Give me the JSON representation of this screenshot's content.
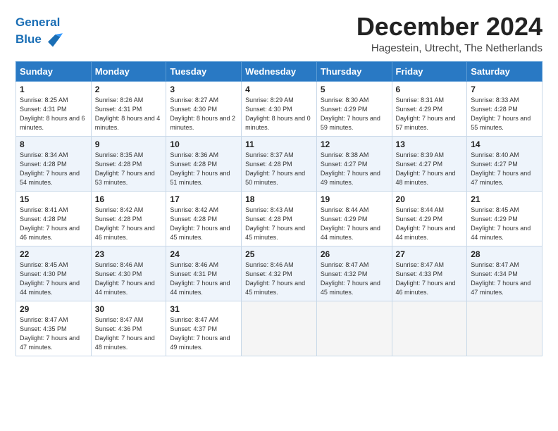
{
  "header": {
    "logo_line1": "General",
    "logo_line2": "Blue",
    "month": "December 2024",
    "location": "Hagestein, Utrecht, The Netherlands"
  },
  "weekdays": [
    "Sunday",
    "Monday",
    "Tuesday",
    "Wednesday",
    "Thursday",
    "Friday",
    "Saturday"
  ],
  "weeks": [
    [
      {
        "day": "1",
        "sunrise": "8:25 AM",
        "sunset": "4:31 PM",
        "daylight": "8 hours and 6 minutes."
      },
      {
        "day": "2",
        "sunrise": "8:26 AM",
        "sunset": "4:31 PM",
        "daylight": "8 hours and 4 minutes."
      },
      {
        "day": "3",
        "sunrise": "8:27 AM",
        "sunset": "4:30 PM",
        "daylight": "8 hours and 2 minutes."
      },
      {
        "day": "4",
        "sunrise": "8:29 AM",
        "sunset": "4:30 PM",
        "daylight": "8 hours and 0 minutes."
      },
      {
        "day": "5",
        "sunrise": "8:30 AM",
        "sunset": "4:29 PM",
        "daylight": "7 hours and 59 minutes."
      },
      {
        "day": "6",
        "sunrise": "8:31 AM",
        "sunset": "4:29 PM",
        "daylight": "7 hours and 57 minutes."
      },
      {
        "day": "7",
        "sunrise": "8:33 AM",
        "sunset": "4:28 PM",
        "daylight": "7 hours and 55 minutes."
      }
    ],
    [
      {
        "day": "8",
        "sunrise": "8:34 AM",
        "sunset": "4:28 PM",
        "daylight": "7 hours and 54 minutes."
      },
      {
        "day": "9",
        "sunrise": "8:35 AM",
        "sunset": "4:28 PM",
        "daylight": "7 hours and 53 minutes."
      },
      {
        "day": "10",
        "sunrise": "8:36 AM",
        "sunset": "4:28 PM",
        "daylight": "7 hours and 51 minutes."
      },
      {
        "day": "11",
        "sunrise": "8:37 AM",
        "sunset": "4:28 PM",
        "daylight": "7 hours and 50 minutes."
      },
      {
        "day": "12",
        "sunrise": "8:38 AM",
        "sunset": "4:27 PM",
        "daylight": "7 hours and 49 minutes."
      },
      {
        "day": "13",
        "sunrise": "8:39 AM",
        "sunset": "4:27 PM",
        "daylight": "7 hours and 48 minutes."
      },
      {
        "day": "14",
        "sunrise": "8:40 AM",
        "sunset": "4:27 PM",
        "daylight": "7 hours and 47 minutes."
      }
    ],
    [
      {
        "day": "15",
        "sunrise": "8:41 AM",
        "sunset": "4:28 PM",
        "daylight": "7 hours and 46 minutes."
      },
      {
        "day": "16",
        "sunrise": "8:42 AM",
        "sunset": "4:28 PM",
        "daylight": "7 hours and 46 minutes."
      },
      {
        "day": "17",
        "sunrise": "8:42 AM",
        "sunset": "4:28 PM",
        "daylight": "7 hours and 45 minutes."
      },
      {
        "day": "18",
        "sunrise": "8:43 AM",
        "sunset": "4:28 PM",
        "daylight": "7 hours and 45 minutes."
      },
      {
        "day": "19",
        "sunrise": "8:44 AM",
        "sunset": "4:29 PM",
        "daylight": "7 hours and 44 minutes."
      },
      {
        "day": "20",
        "sunrise": "8:44 AM",
        "sunset": "4:29 PM",
        "daylight": "7 hours and 44 minutes."
      },
      {
        "day": "21",
        "sunrise": "8:45 AM",
        "sunset": "4:29 PM",
        "daylight": "7 hours and 44 minutes."
      }
    ],
    [
      {
        "day": "22",
        "sunrise": "8:45 AM",
        "sunset": "4:30 PM",
        "daylight": "7 hours and 44 minutes."
      },
      {
        "day": "23",
        "sunrise": "8:46 AM",
        "sunset": "4:30 PM",
        "daylight": "7 hours and 44 minutes."
      },
      {
        "day": "24",
        "sunrise": "8:46 AM",
        "sunset": "4:31 PM",
        "daylight": "7 hours and 44 minutes."
      },
      {
        "day": "25",
        "sunrise": "8:46 AM",
        "sunset": "4:32 PM",
        "daylight": "7 hours and 45 minutes."
      },
      {
        "day": "26",
        "sunrise": "8:47 AM",
        "sunset": "4:32 PM",
        "daylight": "7 hours and 45 minutes."
      },
      {
        "day": "27",
        "sunrise": "8:47 AM",
        "sunset": "4:33 PM",
        "daylight": "7 hours and 46 minutes."
      },
      {
        "day": "28",
        "sunrise": "8:47 AM",
        "sunset": "4:34 PM",
        "daylight": "7 hours and 47 minutes."
      }
    ],
    [
      {
        "day": "29",
        "sunrise": "8:47 AM",
        "sunset": "4:35 PM",
        "daylight": "7 hours and 47 minutes."
      },
      {
        "day": "30",
        "sunrise": "8:47 AM",
        "sunset": "4:36 PM",
        "daylight": "7 hours and 48 minutes."
      },
      {
        "day": "31",
        "sunrise": "8:47 AM",
        "sunset": "4:37 PM",
        "daylight": "7 hours and 49 minutes."
      },
      null,
      null,
      null,
      null
    ]
  ]
}
